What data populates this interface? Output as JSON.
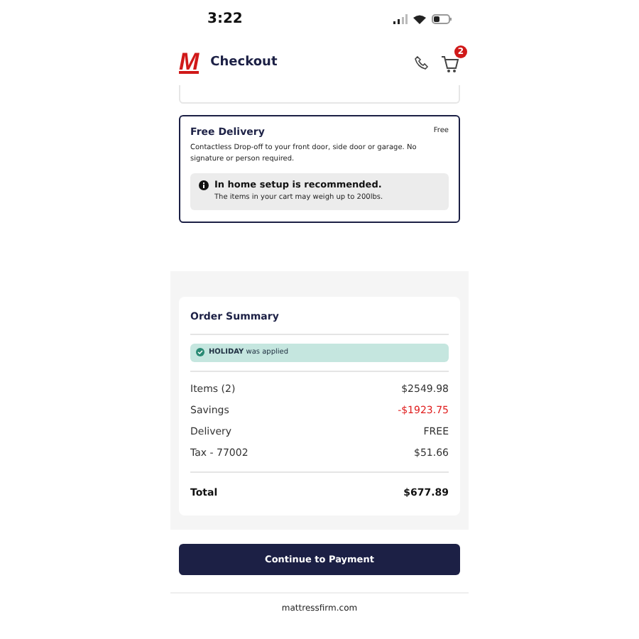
{
  "status_bar": {
    "time": "3:22"
  },
  "header": {
    "logo": "M",
    "title": "Checkout",
    "cart_count": "2"
  },
  "delivery": {
    "title": "Free Delivery",
    "price": "Free",
    "description": "Contactless Drop-off to your front door, side door or garage. No signature or person required.",
    "notice_title": "In home setup is recommended.",
    "notice_text": "The items in your cart may weigh up to 200lbs.",
    "selected": true
  },
  "order_summary": {
    "title": "Order Summary",
    "promo": "**HOLIDAY** was applied",
    "lines": [
      {
        "label": "Items (2)",
        "value": "$2549.98",
        "kind": "normal"
      },
      {
        "label": "Savings",
        "value": "-$1923.75",
        "kind": "discount"
      },
      {
        "label": "Delivery",
        "value": "FREE",
        "kind": "normal"
      },
      {
        "label": "Tax - 77002",
        "value": "$51.66",
        "kind": "normal"
      }
    ],
    "total_label": "Total",
    "total_value": "$677.89"
  },
  "continue_button": "Continue to Payment",
  "footer": "mattressfirm.com"
}
